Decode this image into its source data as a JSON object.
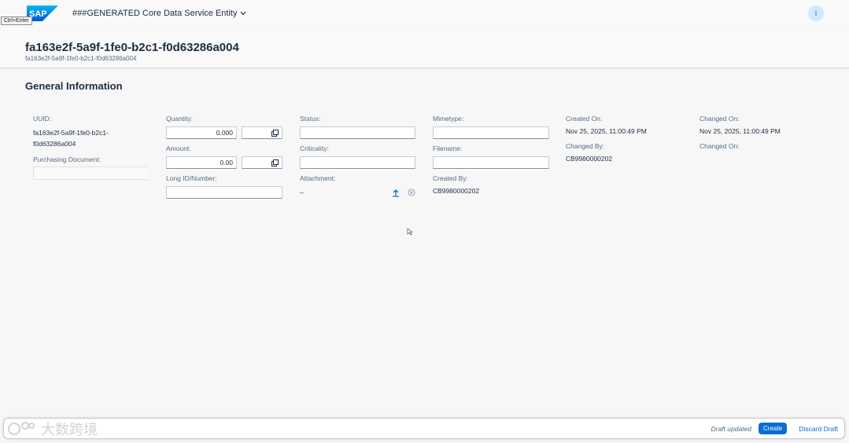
{
  "shell": {
    "logo_text": "SAP",
    "tooltip": "Ctrl+Enter",
    "app_title": "###GENERATED Core Data Service Entity",
    "avatar_initial": "I"
  },
  "header": {
    "title": "fa163e2f-5a9f-1fe0-b2c1-f0d63286a004",
    "subtitle": "fa163e2f-5a9f-1fe0-b2c1-f0d63286a004"
  },
  "section": {
    "title": "General Information"
  },
  "fields": {
    "uuid_label": "UUID:",
    "uuid_value_line1": "fa163e2f-5a9f-1fe0-b2c1-",
    "uuid_value_line2": "f0d63286a004",
    "purchasing_document_label": "Purchasing Document:",
    "purchasing_document_value": "",
    "quantity_label": "Quantity:",
    "quantity_value": "0.000",
    "quantity_unit": "",
    "amount_label": "Amount:",
    "amount_value": "0.00",
    "amount_currency": "",
    "long_id_label": "Long ID/Number:",
    "long_id_value": "",
    "status_label": "Status:",
    "status_value": "",
    "criticality_label": "Criticality:",
    "criticality_value": "",
    "attachment_label": "Attachment:",
    "attachment_value": "–",
    "mimetype_label": "Mimetype:",
    "mimetype_value": "",
    "filename_label": "Filename:",
    "filename_value": "",
    "created_by_label": "Created By:",
    "created_by_value": "CB9980000202",
    "created_on_label": "Created On:",
    "created_on_value": "Nov 25, 2025, 11:00:49 PM",
    "changed_by_label": "Changed By:",
    "changed_by_value": "CB9980000202",
    "changed_on_label": "Changed On:",
    "changed_on_value": "Nov 25, 2025, 11:00:49 PM",
    "changed_on2_label": "Changed On:"
  },
  "footer": {
    "draft_status": "Draft updated",
    "create_label": "Create",
    "discard_label": "Discard Draft"
  },
  "watermark": {
    "text": "大数跨境"
  },
  "colors": {
    "brand_blue": "#0a6ed1",
    "background": "#f7f7f8",
    "text": "#1d2d3e",
    "label": "#556b82"
  },
  "icons": [
    "sap-logo",
    "chevron-down-icon",
    "value-help-icon",
    "upload-icon",
    "clear-icon",
    "cursor-icon"
  ]
}
